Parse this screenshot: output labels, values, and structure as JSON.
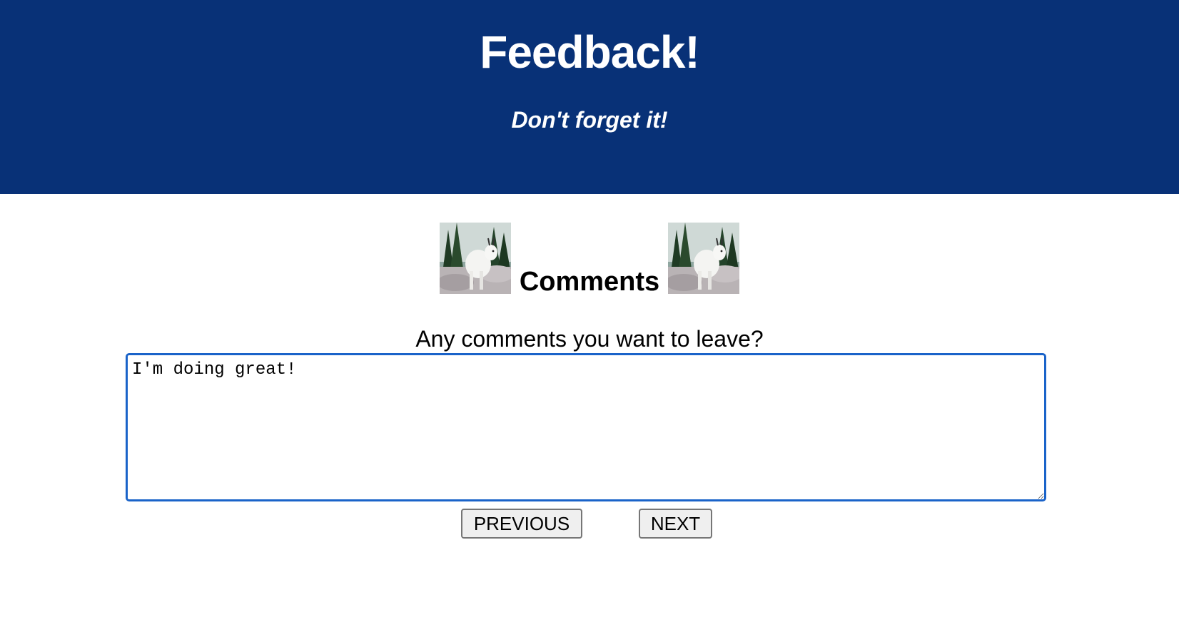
{
  "header": {
    "title": "Feedback!",
    "subtitle": "Don't forget it!"
  },
  "section": {
    "title": "Comments",
    "left_image": "mountain-goat-image",
    "right_image": "mountain-goat-image"
  },
  "form": {
    "prompt": "Any comments you want to leave?",
    "comment_value": "I'm doing great!",
    "previous_label": "PREVIOUS",
    "next_label": "NEXT"
  },
  "colors": {
    "header_bg": "#083177",
    "focus_border": "#1a63c9"
  }
}
